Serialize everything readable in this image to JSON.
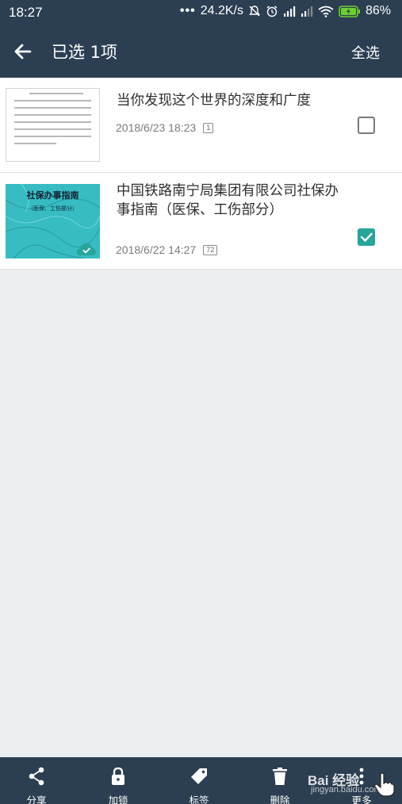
{
  "status_bar": {
    "time": "18:27",
    "dots": "•••",
    "speed": "24.2K/s",
    "battery": "86%"
  },
  "app_bar": {
    "title": "已选 1项",
    "select_all": "全选"
  },
  "items": [
    {
      "title": "当你发现这个世界的深度和广度",
      "date": "2018/6/23 18:23",
      "pages": "1",
      "selected": false
    },
    {
      "title": "中国铁路南宁局集团有限公司社保办事指南（医保、工伤部分）",
      "date": "2018/6/22 14:27",
      "pages": "72",
      "selected": true,
      "cover_title": "社保办事指南",
      "cover_subtitle": "（医保、工伤部分）"
    }
  ],
  "toolbar": {
    "share": "分享",
    "lock": "加锁",
    "tag": "标签",
    "delete": "删除",
    "more": "更多"
  },
  "watermark": {
    "main": "Bai 经验",
    "sub": "jingyan.baidu.com"
  },
  "colors": {
    "bar": "#2c3f52",
    "accent": "#26a59a",
    "background": "#ecefef"
  }
}
